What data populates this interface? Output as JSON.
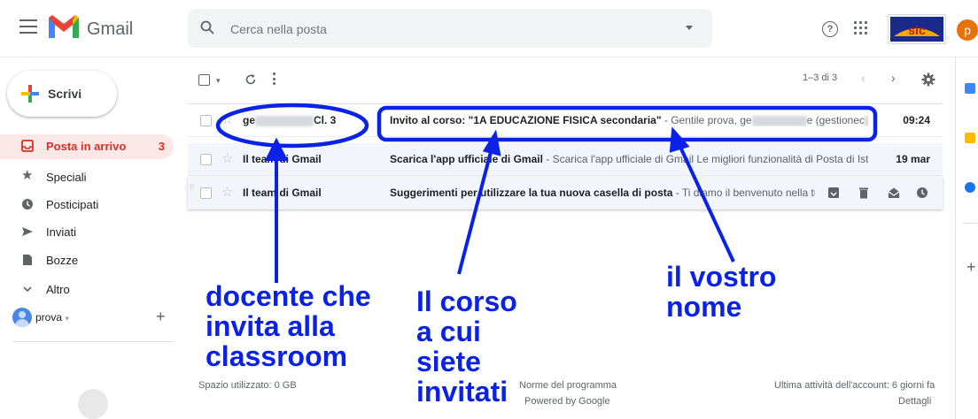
{
  "header": {
    "brand": "Gmail",
    "search_placeholder": "Cerca nella posta",
    "help_glyph": "?",
    "avatar_letter": "p",
    "account_logo_text": "sic"
  },
  "sidebar": {
    "compose_label": "Scrivi",
    "items": [
      {
        "label": "Posta in arrivo",
        "count": "3",
        "icon": "inbox-icon"
      },
      {
        "label": "Speciali",
        "icon": "star-icon"
      },
      {
        "label": "Posticipati",
        "icon": "clock-icon"
      },
      {
        "label": "Inviati",
        "icon": "send-icon"
      },
      {
        "label": "Bozze",
        "icon": "draft-icon"
      },
      {
        "label": "Altro",
        "icon": "chevron-down-icon"
      }
    ],
    "account_name": "prova",
    "add_glyph": "+"
  },
  "toolbar": {
    "pager": "1–3 di 3"
  },
  "emails": [
    {
      "sender_prefix": "ge",
      "sender_suffix": "Cl. 3",
      "subject": "Invito al corso: \"1A EDUCAZIONE FISICA secondaria\"",
      "snippet": " - Gentile prova, ge",
      "snippet_tail": "e (gestionec",
      "time": "09:24"
    },
    {
      "sender": "Il team di Gmail",
      "subject": "Scarica l'app ufficiale di Gmail",
      "snippet": " - Scarica l'app ufficiale di Gmail Le migliori funzionalità di Posta di Ist...",
      "time": "19 mar"
    },
    {
      "sender": "Il team di Gmail",
      "subject": "Suggerimenti per utilizzare la tua nuova casella di posta",
      "snippet": " - Ti diamo il benvenuto nella tua ..."
    }
  ],
  "footer": {
    "storage": "Spazio utilizzato: 0 GB",
    "terms": "Norme del programma",
    "powered": "Powered by Google",
    "activity": "Ultima attività dell'account: 6 giorni fa",
    "details": "Dettagli"
  },
  "annotations": {
    "teacher": [
      "docente che",
      "invita alla",
      "classroom"
    ],
    "course": [
      "Il corso",
      "a cui",
      "siete",
      "invitati"
    ],
    "name": [
      "il vostro",
      "nome"
    ]
  },
  "colors": {
    "annotation": "#0a22e6",
    "accent_red": "#d93025",
    "active_bg": "#fce8e6"
  }
}
